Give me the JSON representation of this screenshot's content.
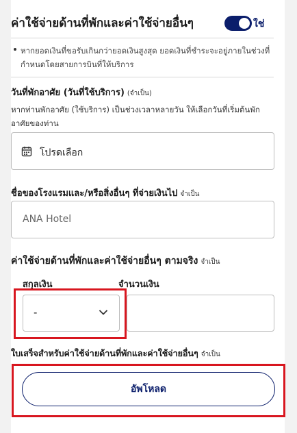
{
  "section": {
    "title": "ค่าใช้จ่ายด้านที่พักและค่าใช้จ่ายอื่นๆ",
    "toggle_label": "ใช่",
    "toggle_on": true,
    "note": "หากยอดเงินที่ขอรับเกินกว่ายอดเงินสูงสุด ยอดเงินที่ชำระจะอยู่ภายในช่วงที่กำหนดโดยสายการบินที่ให้บริการ"
  },
  "stay_date": {
    "label": "วันที่พักอาศัย (วันที่ใช้บริการ)",
    "required": "(จำเป็น)",
    "help": "หากท่านพักอาศัย (ใช้บริการ) เป็นช่วงเวลาหลายวัน ให้เลือกวันที่เริ่มต้นพักอาศัยของท่าน",
    "value": "โปรดเลือก"
  },
  "hotel": {
    "label": "ชื่อของโรงแรมและ/หรือสิ่งอื่นๆ ที่จ่ายเงินไป",
    "required": "จำเป็น",
    "value": "ANA Hotel"
  },
  "actual_expense": {
    "title": "ค่าใช้จ่ายด้านที่พักและค่าใช้จ่ายอื่นๆ ตามจริง",
    "required": "จำเป็น",
    "currency_label": "สกุลเงิน",
    "currency_value": "-",
    "amount_label": "จำนวนเงิน",
    "amount_value": ""
  },
  "receipt": {
    "label": "ใบเสร็จสำหรับค่าใช้จ่ายด้านที่พักและค่าใช้จ่ายอื่นๆ",
    "required": "จำเป็น",
    "upload_label": "อัพโหลด"
  },
  "colors": {
    "accent": "#0b1e6b",
    "highlight": "#d8161f"
  }
}
